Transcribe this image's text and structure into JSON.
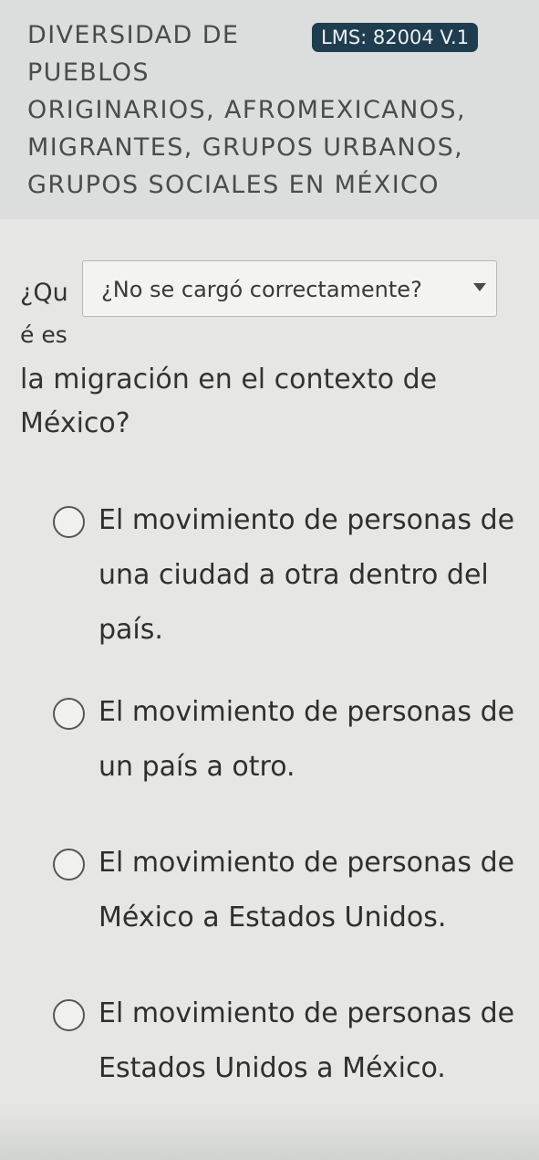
{
  "header": {
    "course_title_lines": [
      "DIVERSIDAD DE",
      "PUEBLOS",
      "ORIGINARIOS, AFROMEXICANOS,",
      "MIGRANTES, GRUPOS URBANOS,",
      "GRUPOS SOCIALES EN MÉXICO"
    ],
    "lms_badge": "LMS: 82004 V.1"
  },
  "question": {
    "text_part1": "¿Qu",
    "text_part2": "é es",
    "text_rest": "la migración en el contexto de México?"
  },
  "tooltip": {
    "label": "¿No se cargó correctamente?",
    "icon": "caret-down-icon"
  },
  "options": [
    {
      "text": "El movimiento de personas de una ciudad a otra dentro del país.",
      "selected": false
    },
    {
      "text": "El movimiento de personas de un país a otro.",
      "selected": false
    },
    {
      "text": "El movimiento de personas de México a Estados Unidos.",
      "selected": false
    },
    {
      "text": "El movimiento de personas de Estados Unidos a México.",
      "selected": false
    }
  ]
}
